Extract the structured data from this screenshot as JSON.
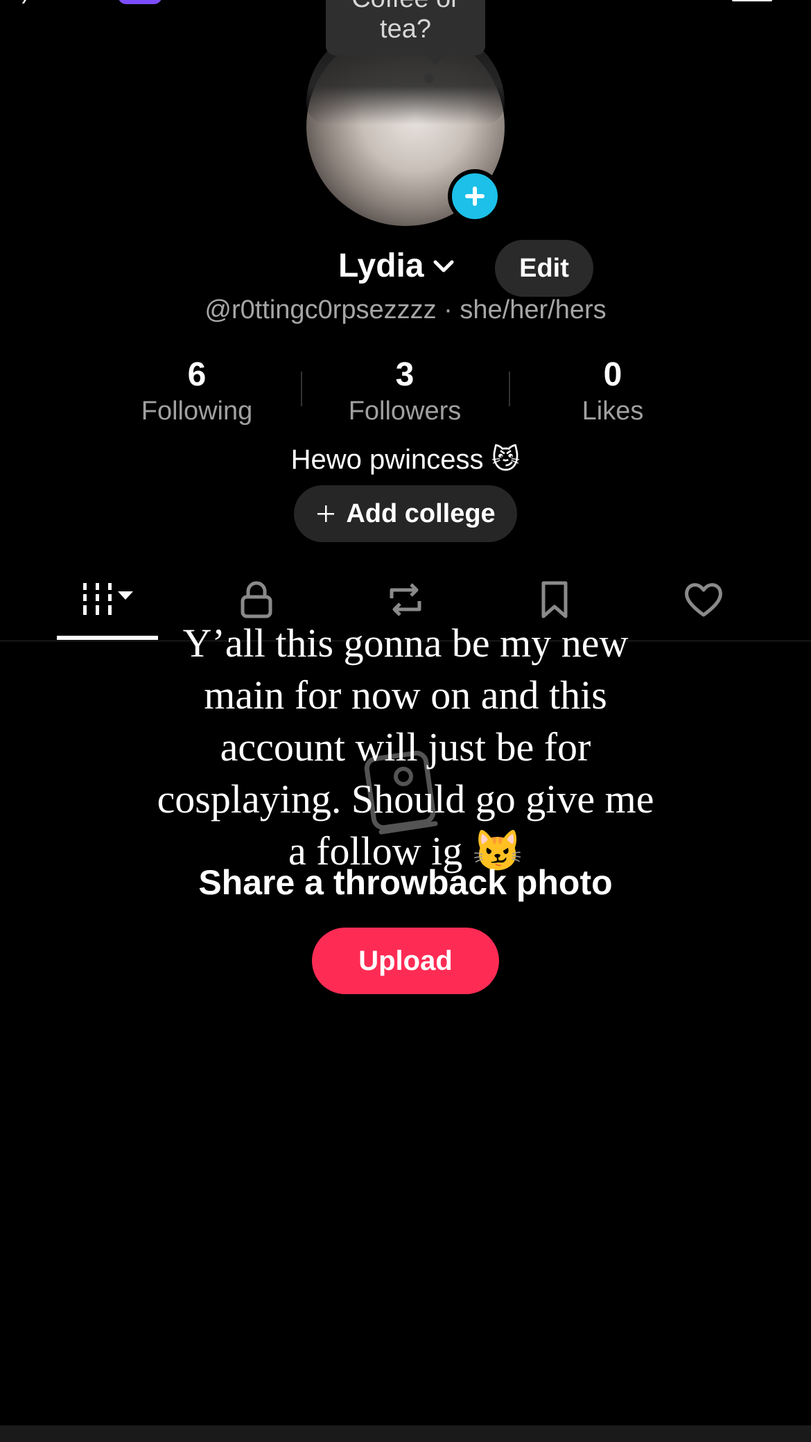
{
  "tooltip": {
    "text": "Coffee or\ntea?"
  },
  "profile": {
    "name": "Lydia",
    "edit_label": "Edit",
    "handle": "@r0ttingc0rpsezzzz · she/her/hers",
    "bio": "Hewo pwincess 😼",
    "add_college_label": "Add college"
  },
  "stats": [
    {
      "value": "6",
      "label": "Following"
    },
    {
      "value": "3",
      "label": "Followers"
    },
    {
      "value": "0",
      "label": "Likes"
    }
  ],
  "tabs": [
    {
      "icon": "videos-grid-icon",
      "active": true
    },
    {
      "icon": "lock-icon",
      "active": false
    },
    {
      "icon": "repost-icon",
      "active": false
    },
    {
      "icon": "bookmark-icon",
      "active": false
    },
    {
      "icon": "heart-icon",
      "active": false
    }
  ],
  "overlay_caption": "Y’all this gonna be my new\nmain for now on and this\naccount will just be for\ncosplaying. Should go give me\na follow ig 😼",
  "empty_state": {
    "title": "Share a throwback photo",
    "upload_label": "Upload"
  },
  "colors": {
    "background": "#000000",
    "accent_cyan": "#1cc0e8",
    "upload_red": "#fe2c55",
    "muted_text": "#a6a6a6"
  }
}
